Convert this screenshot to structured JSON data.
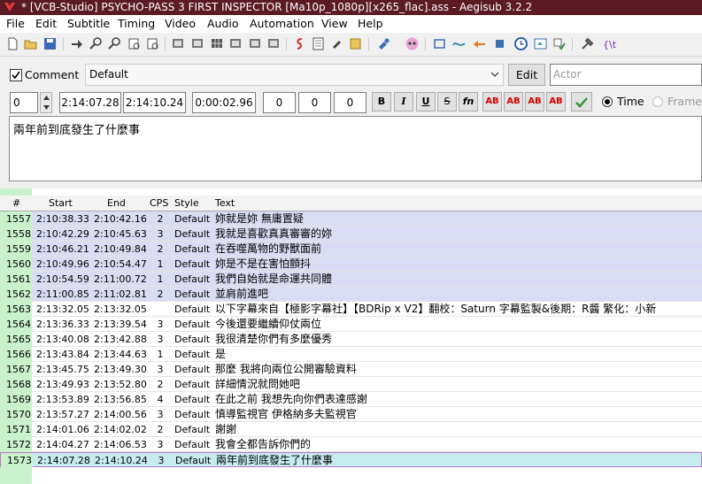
{
  "window": {
    "title": "* [VCB-Studio] PSYCHO-PASS 3 FIRST INSPECTOR [Ma10p_1080p][x265_flac].ass - Aegisub 3.2.2"
  },
  "menu": [
    "File",
    "Edit",
    "Subtitle",
    "Timing",
    "Video",
    "Audio",
    "Automation",
    "View",
    "Help"
  ],
  "editor": {
    "comment_label": "Comment",
    "style": "Default",
    "edit_button": "Edit",
    "actor_placeholder": "Actor",
    "layer": "0",
    "start": "2:14:07.28",
    "end": "2:14:10.24",
    "duration": "0:00:02.96",
    "margin_l": "0",
    "margin_r": "0",
    "margin_v": "0",
    "fmt": {
      "bold": "B",
      "italic": "I",
      "underline": "U",
      "strike": "S",
      "fn": "fn"
    },
    "color_buttons": [
      "AB",
      "AB",
      "AB",
      "AB"
    ],
    "time_label": "Time",
    "frame_label": "Frame",
    "text": "兩年前到底發生了什麼事"
  },
  "grid": {
    "columns": {
      "num": "#",
      "start": "Start",
      "end": "End",
      "cps": "CPS",
      "style": "Style",
      "text": "Text"
    },
    "rows": [
      {
        "num": "1557",
        "start": "2:10:38.33",
        "end": "2:10:42.16",
        "cps": "2",
        "style": "Default",
        "text": "妳就是妳 無庸置疑"
      },
      {
        "num": "1558",
        "start": "2:10:42.29",
        "end": "2:10:45.63",
        "cps": "3",
        "style": "Default",
        "text": "我就是喜歡真真審審的妳"
      },
      {
        "num": "1559",
        "start": "2:10:46.21",
        "end": "2:10:49.84",
        "cps": "2",
        "style": "Default",
        "text": "在吞噬萬物的野獸面前"
      },
      {
        "num": "1560",
        "start": "2:10:49.96",
        "end": "2:10:54.47",
        "cps": "1",
        "style": "Default",
        "text": "妳是不是在害怕顫抖"
      },
      {
        "num": "1561",
        "start": "2:10:54.59",
        "end": "2:11:00.72",
        "cps": "1",
        "style": "Default",
        "text": "我們自始就是命運共同體"
      },
      {
        "num": "1562",
        "start": "2:11:00.85",
        "end": "2:11:02.81",
        "cps": "2",
        "style": "Default",
        "text": "並肩前進吧"
      },
      {
        "num": "1563",
        "start": "2:13:32.05",
        "end": "2:13:32.05",
        "cps": "",
        "style": "Default",
        "text": "以下字幕來自【極影字幕社】【BDRip x V2】翻校：Saturn 字幕監製&後期：R醬 繁化：小新"
      },
      {
        "num": "1564",
        "start": "2:13:36.33",
        "end": "2:13:39.54",
        "cps": "3",
        "style": "Default",
        "text": "今後還要繼續仰仗兩位"
      },
      {
        "num": "1565",
        "start": "2:13:40.08",
        "end": "2:13:42.88",
        "cps": "3",
        "style": "Default",
        "text": "我很清楚你們有多麼優秀"
      },
      {
        "num": "1566",
        "start": "2:13:43.84",
        "end": "2:13:44.63",
        "cps": "1",
        "style": "Default",
        "text": "是"
      },
      {
        "num": "1567",
        "start": "2:13:45.75",
        "end": "2:13:49.30",
        "cps": "3",
        "style": "Default",
        "text": "那麼 我將向兩位公開審驗資料"
      },
      {
        "num": "1568",
        "start": "2:13:49.93",
        "end": "2:13:52.80",
        "cps": "2",
        "style": "Default",
        "text": "詳細情況就問她吧"
      },
      {
        "num": "1569",
        "start": "2:13:53.89",
        "end": "2:13:56.85",
        "cps": "4",
        "style": "Default",
        "text": "在此之前 我想先向你們表達感謝"
      },
      {
        "num": "1570",
        "start": "2:13:57.27",
        "end": "2:14:00.56",
        "cps": "3",
        "style": "Default",
        "text": "慎導監視官 伊格納多夫監視官"
      },
      {
        "num": "1571",
        "start": "2:14:01.06",
        "end": "2:14:02.02",
        "cps": "2",
        "style": "Default",
        "text": "謝謝"
      },
      {
        "num": "1572",
        "start": "2:14:04.27",
        "end": "2:14:06.53",
        "cps": "3",
        "style": "Default",
        "text": "我會全都告訴你們的"
      },
      {
        "num": "1573",
        "start": "2:14:07.28",
        "end": "2:14:10.24",
        "cps": "3",
        "style": "Default",
        "text": "兩年前到底發生了什麼事"
      }
    ]
  }
}
